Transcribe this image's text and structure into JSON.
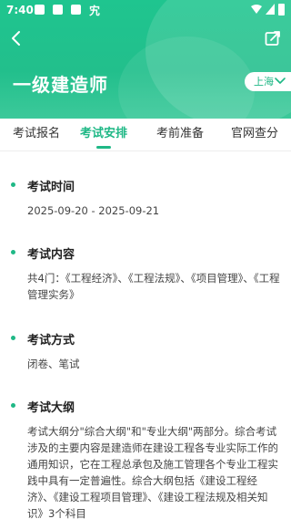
{
  "status_bar": {
    "time": "7:40",
    "app_glyph": "宄"
  },
  "header": {
    "title": "一级建造师",
    "city": "上海"
  },
  "tabs": [
    {
      "label": "考试报名"
    },
    {
      "label": "考试安排"
    },
    {
      "label": "考前准备"
    },
    {
      "label": "官网查分"
    }
  ],
  "sections": [
    {
      "title": "考试时间",
      "body": "2025-09-20 - 2025-09-21"
    },
    {
      "title": "考试内容",
      "body": "共4门：《工程经济》、《工程法规》、《项目管理》、《工程管理实务》"
    },
    {
      "title": "考试方式",
      "body": "闭卷、笔试"
    },
    {
      "title": "考试大纲",
      "body": "考试大纲分\"综合大纲\"和\"专业大纲\"两部分。综合考试涉及的主要内容是建造师在建设工程各专业实际工作的通用知识，它在工程总承包及施工管理各个专业工程实践中具有一定普遍性。综合大纲包括《建设工程经济》、《建设工程项目管理》、《建设工程法规及相关知识》3个科目"
    }
  ],
  "colors": {
    "accent": "#1fb886",
    "header_bg": "#22bf8c"
  },
  "icons": [
    "back-arrow-icon",
    "edit-share-icon",
    "chevron-down-icon"
  ]
}
